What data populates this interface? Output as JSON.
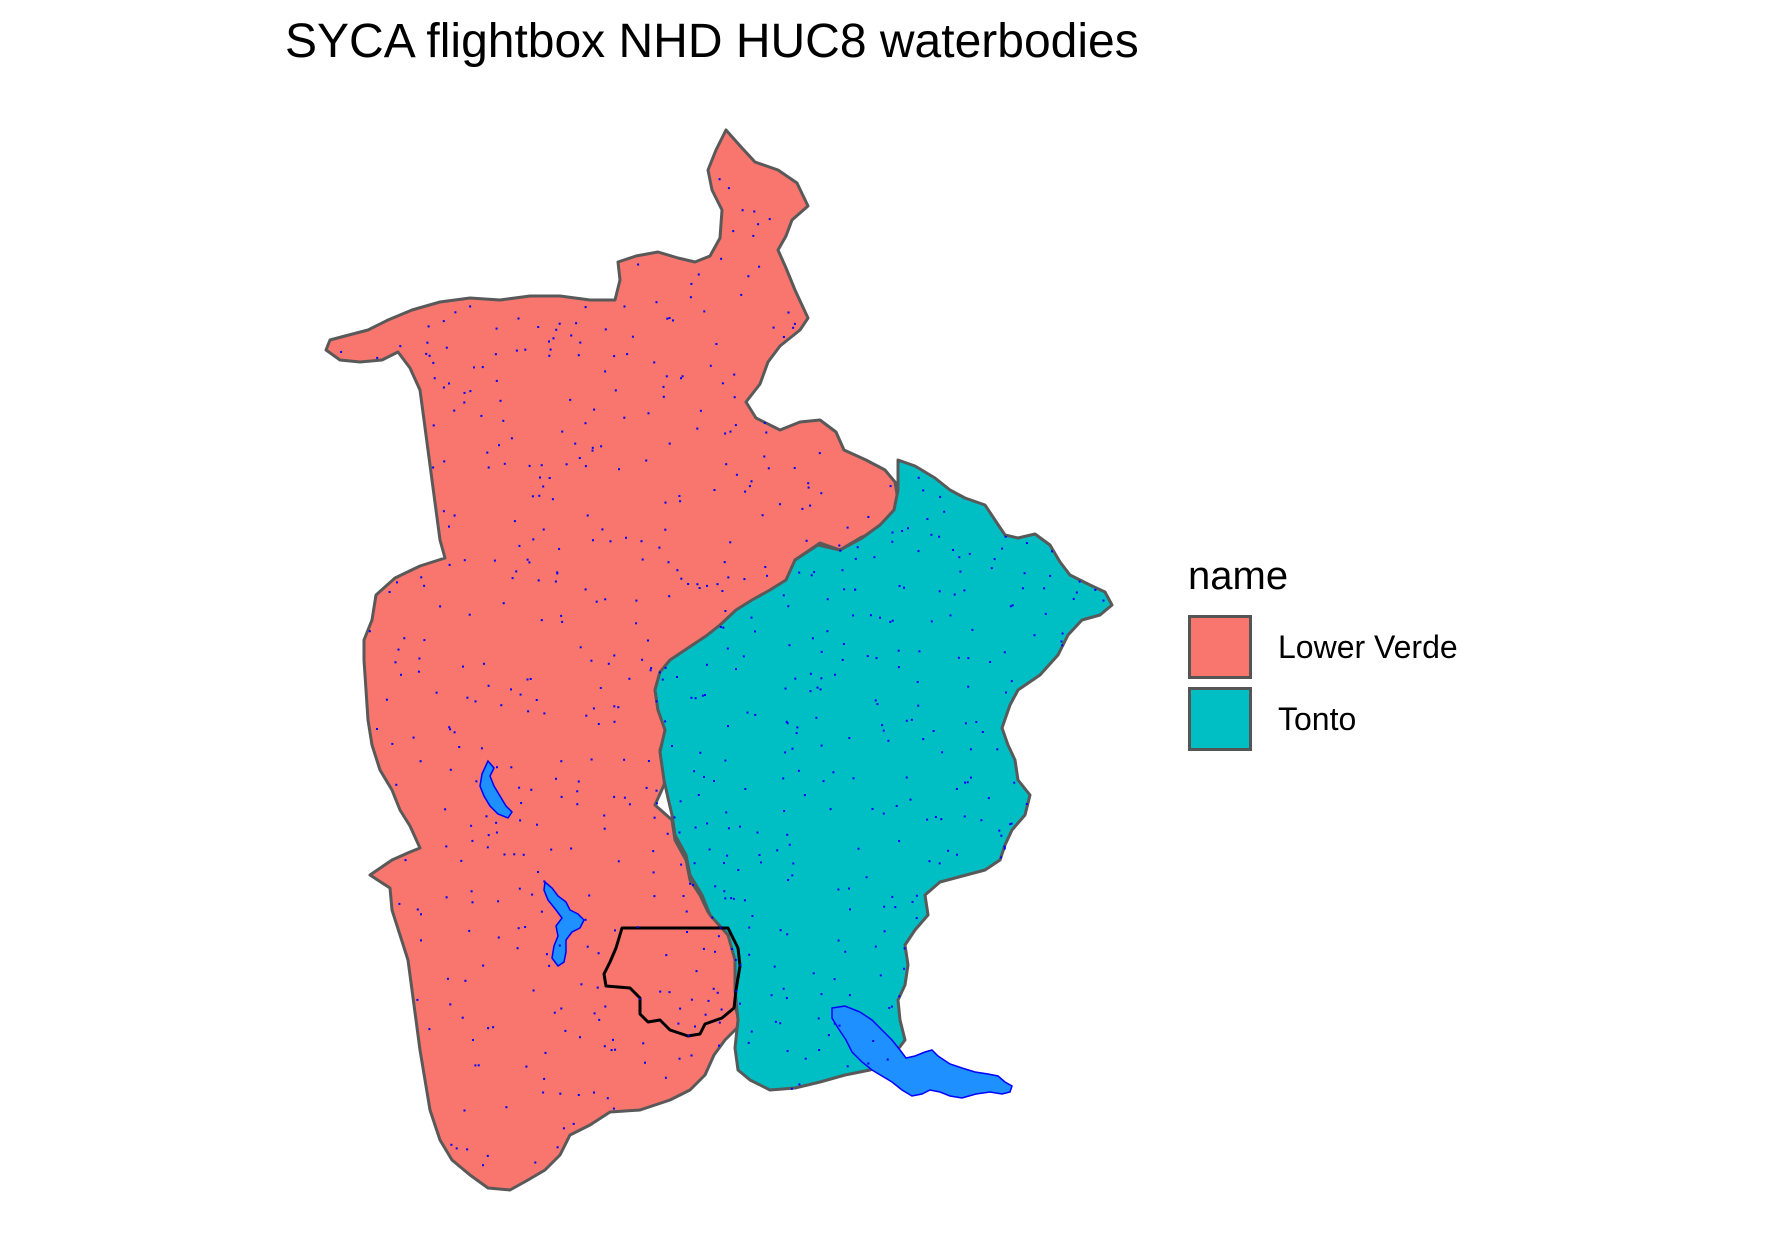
{
  "title": "SYCA flightbox NHD HUC8 waterbodies",
  "legend": {
    "title": "name",
    "items": [
      {
        "label": "Lower Verde",
        "color": "#F8766D"
      },
      {
        "label": "Tonto",
        "color": "#00BFC4"
      }
    ]
  },
  "colors": {
    "boundary": "#595959",
    "waterbody_fill": "#1E90FF",
    "waterbody_outline": "#0000FF",
    "flightbox_outline": "#000000"
  }
}
